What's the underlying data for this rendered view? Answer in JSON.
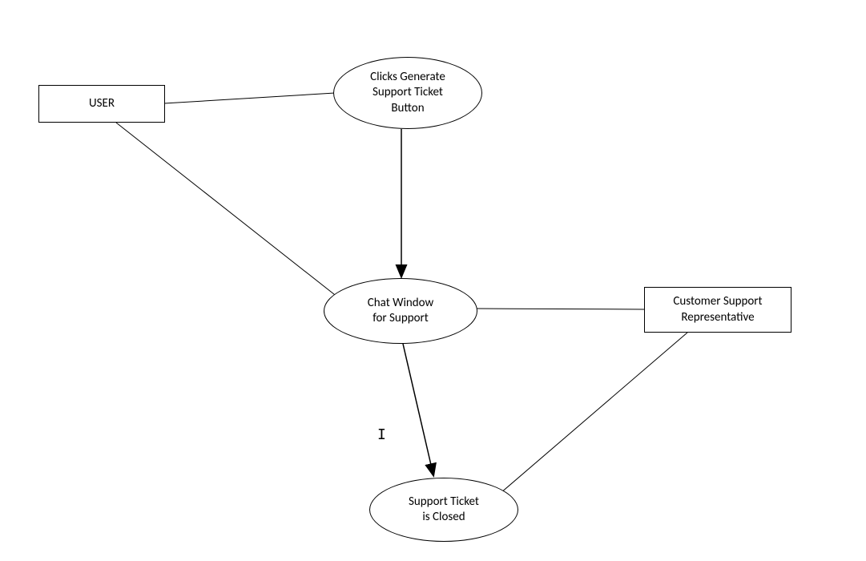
{
  "nodes": {
    "user": {
      "label": "USER"
    },
    "clicks": {
      "label": "Clicks Generate\nSupport Ticket\nButton"
    },
    "chat": {
      "label": "Chat Window\nfor Support"
    },
    "csr": {
      "label": "Customer Support\nRepresentative"
    },
    "closed": {
      "label": "Support Ticket\nis Closed"
    }
  }
}
